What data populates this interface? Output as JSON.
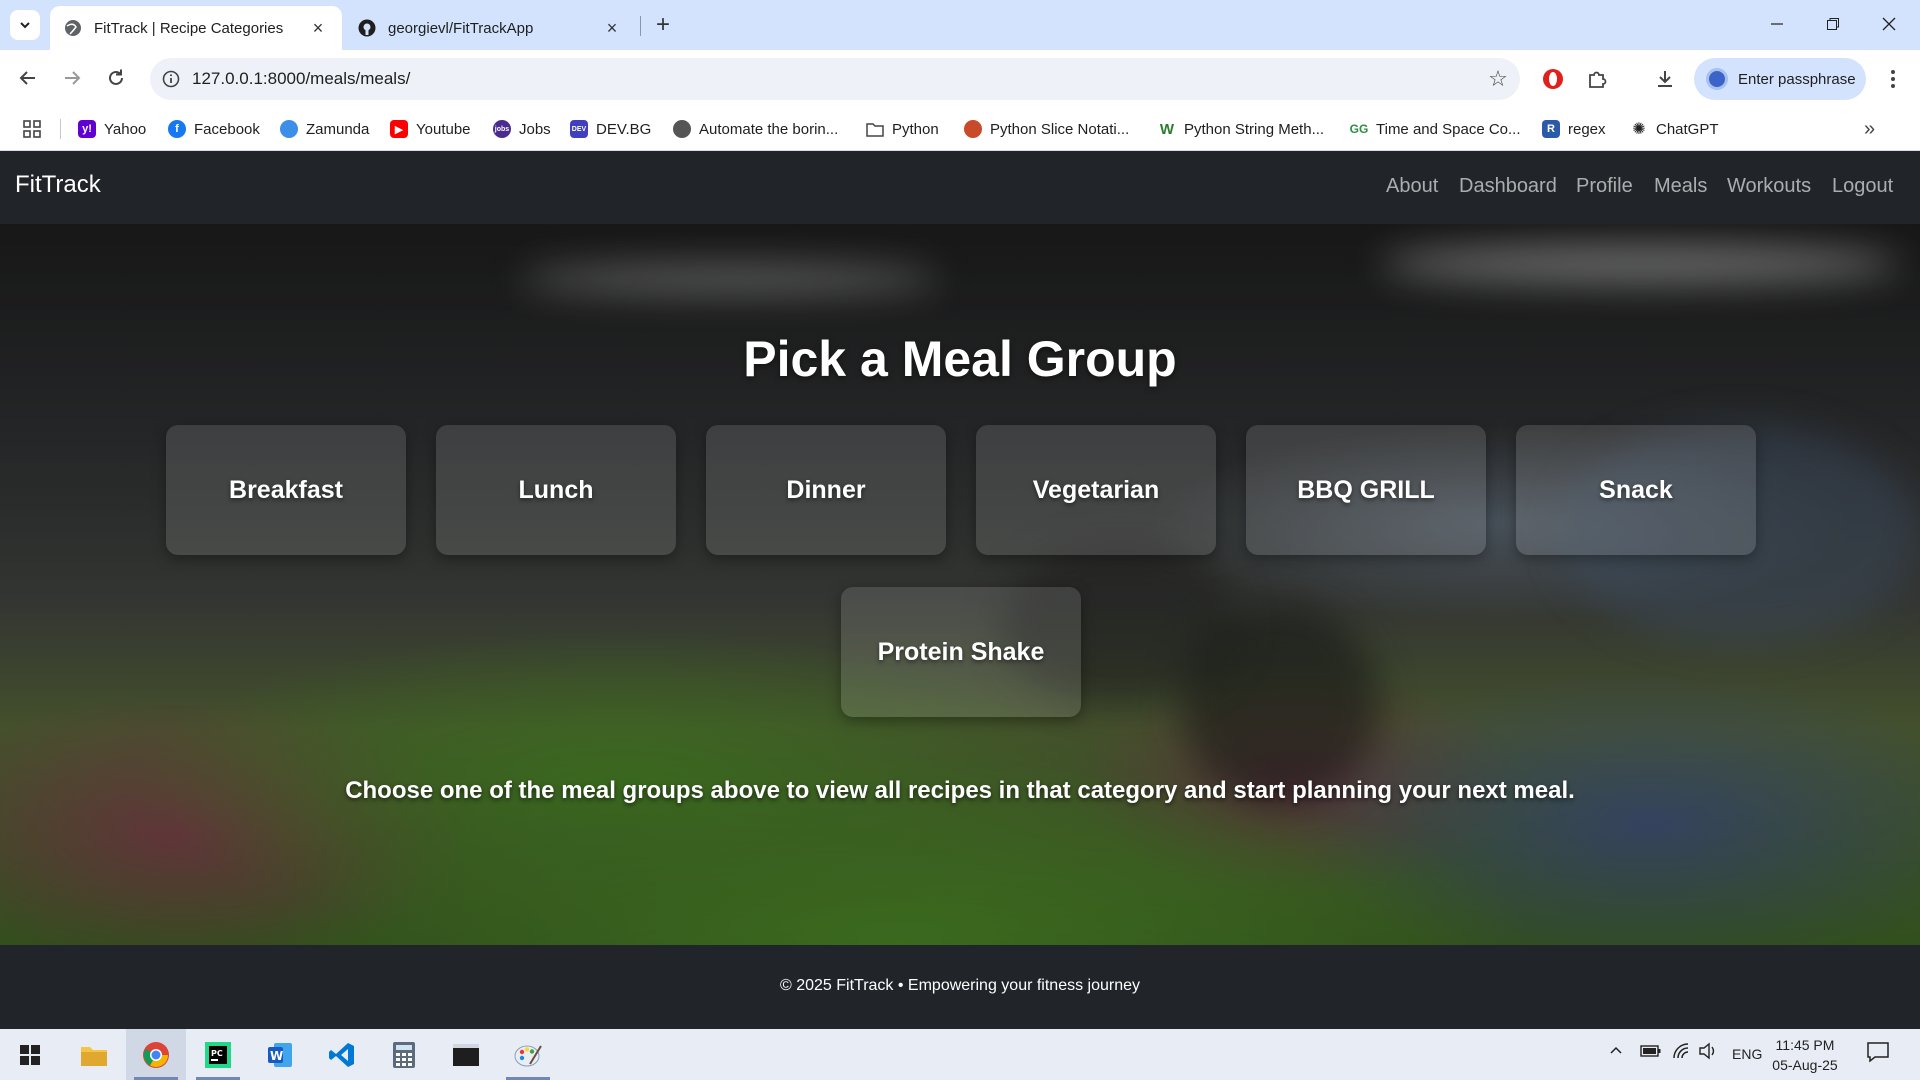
{
  "browser": {
    "tabs": [
      {
        "title": "FitTrack | Recipe Categories",
        "active": true
      },
      {
        "title": "georgievl/FitTrackApp",
        "active": false
      }
    ],
    "url": "127.0.0.1:8000/meals/meals/",
    "profile_label": "Enter passphrase",
    "bookmarks": [
      {
        "label": "Yahoo",
        "icon": "yahoo-icon",
        "color": "#6001d2"
      },
      {
        "label": "Facebook",
        "icon": "facebook-icon",
        "color": "#1877f2"
      },
      {
        "label": "Zamunda",
        "icon": "zamunda-icon",
        "color": "#3c8ee8"
      },
      {
        "label": "Youtube",
        "icon": "youtube-icon",
        "color": "#ff0000"
      },
      {
        "label": "Jobs",
        "icon": "jobs-icon",
        "color": "#4b2b8f"
      },
      {
        "label": "DEV.BG",
        "icon": "devbg-icon",
        "color": "#3f3fbf"
      },
      {
        "label": "Automate the borin...",
        "icon": "globe-icon",
        "color": "#555555"
      },
      {
        "label": "Python",
        "icon": "folder-icon",
        "color": "#444444"
      },
      {
        "label": "Python Slice Notati...",
        "icon": "site-icon",
        "color": "#c84a2a"
      },
      {
        "label": "Python String Meth...",
        "icon": "w-icon",
        "color": "#2d7d2d"
      },
      {
        "label": "Time and Space Co...",
        "icon": "gfg-icon",
        "color": "#2f8d46"
      },
      {
        "label": "regex",
        "icon": "r-icon",
        "color": "#2b5aa8"
      },
      {
        "label": "ChatGPT",
        "icon": "chatgpt-icon",
        "color": "#222222"
      }
    ]
  },
  "site": {
    "brand": "FitTrack",
    "nav": [
      "About",
      "Dashboard",
      "Profile",
      "Meals",
      "Workouts",
      "Logout"
    ],
    "hero": {
      "title": "Pick a Meal Group",
      "categories": [
        "Breakfast",
        "Lunch",
        "Dinner",
        "Vegetarian",
        "BBQ GRILL",
        "Snack",
        "Protein Shake"
      ],
      "subtitle": "Choose one of the meal groups above to view all recipes in that category and start planning your next meal."
    },
    "footer": "© 2025 FitTrack • Empowering your fitness journey"
  },
  "taskbar": {
    "language": "ENG",
    "time": "11:45 PM",
    "date": "05-Aug-25"
  }
}
